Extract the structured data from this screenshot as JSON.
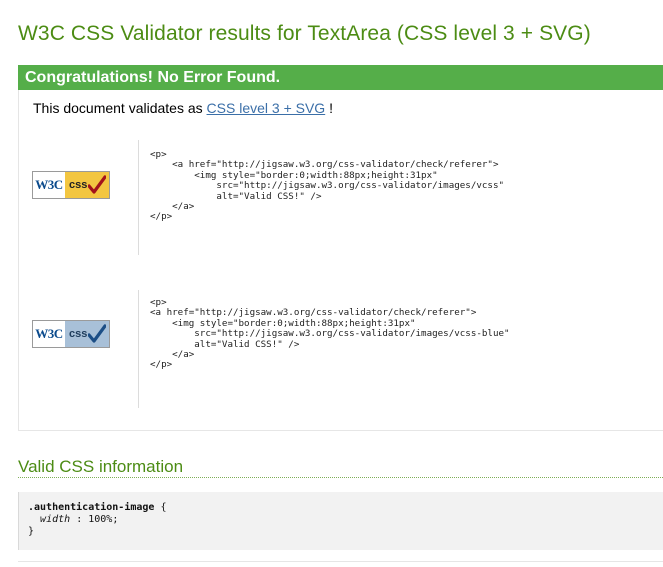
{
  "title": "W3C CSS Validator results for TextArea (CSS level 3 + SVG)",
  "banner": "Congratulations! No Error Found.",
  "validates": {
    "prefix": "This document validates as",
    "link": "CSS level 3 + SVG",
    "suffix": "!"
  },
  "badges": [
    {
      "w3c": "W3C",
      "css": "css",
      "variant": "gold",
      "check_color": "#a3131b",
      "code": "<p>\n    <a href=\"http://jigsaw.w3.org/css-validator/check/referer\">\n        <img style=\"border:0;width:88px;height:31px\"\n            src=\"http://jigsaw.w3.org/css-validator/images/vcss\"\n            alt=\"Valid CSS!\" />\n    </a>\n</p>"
    },
    {
      "w3c": "W3C",
      "css": "css",
      "variant": "blue",
      "check_color": "#1c4e86",
      "code": "<p>\n<a href=\"http://jigsaw.w3.org/css-validator/check/referer\">\n    <img style=\"border:0;width:88px;height:31px\"\n        src=\"http://jigsaw.w3.org/css-validator/images/vcss-blue\"\n        alt=\"Valid CSS!\" />\n    </a>\n</p>"
    }
  ],
  "valid_info": {
    "heading": "Valid CSS information",
    "selector": ".authentication-image",
    "open_brace": "{",
    "property": "width",
    "separator": ":",
    "value": "100%;",
    "close_brace": "}"
  },
  "colors": {
    "title_green": "#4c8c14",
    "banner_green": "#55ae49",
    "link_blue": "#3b6fa8"
  }
}
